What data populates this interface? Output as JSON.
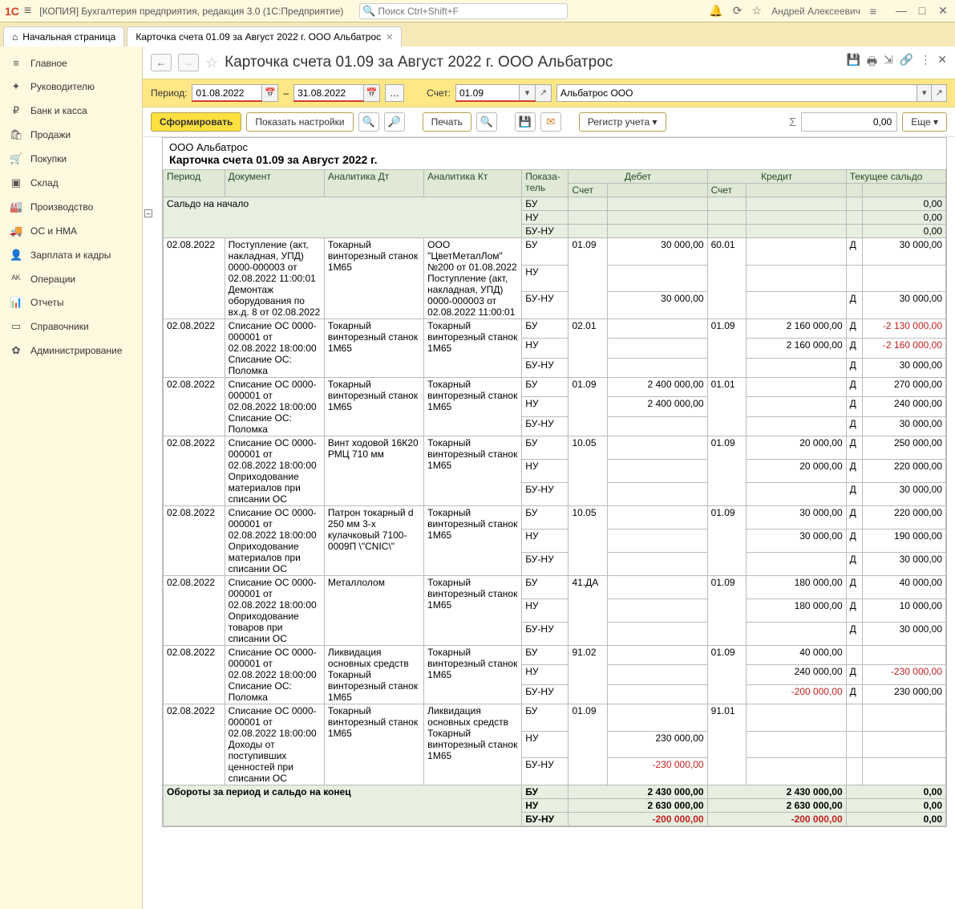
{
  "titlebar": {
    "app_title": "[КОПИЯ] Бухгалтерия предприятия, редакция 3.0  (1С:Предприятие)",
    "search_placeholder": "Поиск Ctrl+Shift+F",
    "user": "Андрей Алексеевич"
  },
  "tabs": {
    "home": "Начальная страница",
    "current": "Карточка счета 01.09 за Август 2022 г. ООО Альбатрос"
  },
  "sidebar": [
    {
      "icon": "≡",
      "label": "Главное"
    },
    {
      "icon": "✦",
      "label": "Руководителю"
    },
    {
      "icon": "₽",
      "label": "Банк и касса"
    },
    {
      "icon": "🛍",
      "label": "Продажи"
    },
    {
      "icon": "🛒",
      "label": "Покупки"
    },
    {
      "icon": "▣",
      "label": "Склад"
    },
    {
      "icon": "🏭",
      "label": "Производство"
    },
    {
      "icon": "🚚",
      "label": "ОС и НМА"
    },
    {
      "icon": "👤",
      "label": "Зарплата и кадры"
    },
    {
      "icon": "ᴬᴷ",
      "label": "Операции"
    },
    {
      "icon": "📊",
      "label": "Отчеты"
    },
    {
      "icon": "▭",
      "label": "Справочники"
    },
    {
      "icon": "✿",
      "label": "Администрирование"
    }
  ],
  "header": {
    "title": "Карточка счета 01.09 за Август 2022 г. ООО Альбатрос"
  },
  "filter": {
    "period_label": "Период:",
    "from": "01.08.2022",
    "dash": "–",
    "to": "31.08.2022",
    "account_label": "Счет:",
    "account": "01.09",
    "org": "Альбатрос ООО"
  },
  "toolbar": {
    "form": "Сформировать",
    "settings": "Показать настройки",
    "print": "Печать",
    "registry": "Регистр учета",
    "sumfield": "0,00",
    "more": "Еще"
  },
  "report": {
    "org": "ООО Альбатрос",
    "title": "Карточка счета 01.09 за Август 2022 г.",
    "columns": {
      "period": "Период",
      "doc": "Документ",
      "adt": "Аналитика Дт",
      "akt": "Аналитика Кт",
      "ind": "Показа-\nтель",
      "debit": "Дебет",
      "credit": "Кредит",
      "balance": "Текущее сальдо",
      "acc": "Счет"
    },
    "opening_label": "Сальдо на начало",
    "opening": {
      "bu": "0,00",
      "nu": "0,00",
      "bunu": "0,00"
    },
    "rows": [
      {
        "date": "02.08.2022",
        "doc": "Поступление (акт, накладная, УПД) 0000-000003 от 02.08.2022 11:00:01\nДемонтаж оборудования по вх.д. 8 от 02.08.2022",
        "adt": "Токарный винторезный станок 1М65",
        "akt": "ООО \"ЦветМеталЛом\" №200 от 01.08.2022\nПоступление (акт, накладная, УПД) 0000-000003 от 02.08.2022 11:00:01",
        "lines": [
          {
            "ind": "БУ",
            "dacc": "01.09",
            "dsum": "30 000,00",
            "cacc": "60.01",
            "csum": "",
            "side": "Д",
            "bal": "30 000,00"
          },
          {
            "ind": "НУ",
            "dacc": "",
            "dsum": "",
            "cacc": "",
            "csum": "",
            "side": "",
            "bal": ""
          },
          {
            "ind": "БУ-НУ",
            "dacc": "",
            "dsum": "30 000,00",
            "cacc": "",
            "csum": "",
            "side": "Д",
            "bal": "30 000,00"
          }
        ]
      },
      {
        "date": "02.08.2022",
        "doc": "Списание ОС 0000-000001 от 02.08.2022 18:00:00\nСписание ОС: Поломка",
        "adt": "Токарный винторезный станок 1М65",
        "akt": "Токарный винторезный станок 1М65",
        "lines": [
          {
            "ind": "БУ",
            "dacc": "02.01",
            "dsum": "",
            "cacc": "01.09",
            "csum": "2 160 000,00",
            "side": "Д",
            "bal": "-2 130 000,00",
            "neg": true
          },
          {
            "ind": "НУ",
            "dacc": "",
            "dsum": "",
            "cacc": "",
            "csum": "2 160 000,00",
            "side": "Д",
            "bal": "-2 160 000,00",
            "neg": true
          },
          {
            "ind": "БУ-НУ",
            "dacc": "",
            "dsum": "",
            "cacc": "",
            "csum": "",
            "side": "Д",
            "bal": "30 000,00"
          }
        ]
      },
      {
        "date": "02.08.2022",
        "doc": "Списание ОС 0000-000001 от 02.08.2022 18:00:00\nСписание ОС: Поломка",
        "adt": "Токарный винторезный станок 1М65",
        "akt": "Токарный винторезный станок 1М65",
        "lines": [
          {
            "ind": "БУ",
            "dacc": "01.09",
            "dsum": "2 400 000,00",
            "cacc": "01.01",
            "csum": "",
            "side": "Д",
            "bal": "270 000,00"
          },
          {
            "ind": "НУ",
            "dacc": "",
            "dsum": "2 400 000,00",
            "cacc": "",
            "csum": "",
            "side": "Д",
            "bal": "240 000,00"
          },
          {
            "ind": "БУ-НУ",
            "dacc": "",
            "dsum": "",
            "cacc": "",
            "csum": "",
            "side": "Д",
            "bal": "30 000,00"
          }
        ]
      },
      {
        "date": "02.08.2022",
        "doc": "Списание ОС 0000-000001 от 02.08.2022 18:00:00\nОприходование материалов при списании ОС",
        "adt": "Винт ходовой 16К20 РМЦ 710 мм",
        "akt": "Токарный винторезный станок 1М65",
        "lines": [
          {
            "ind": "БУ",
            "dacc": "10.05",
            "dsum": "",
            "cacc": "01.09",
            "csum": "20 000,00",
            "side": "Д",
            "bal": "250 000,00"
          },
          {
            "ind": "НУ",
            "dacc": "",
            "dsum": "",
            "cacc": "",
            "csum": "20 000,00",
            "side": "Д",
            "bal": "220 000,00"
          },
          {
            "ind": "БУ-НУ",
            "dacc": "",
            "dsum": "",
            "cacc": "",
            "csum": "",
            "side": "Д",
            "bal": "30 000,00"
          }
        ]
      },
      {
        "date": "02.08.2022",
        "doc": "Списание ОС 0000-000001 от 02.08.2022 18:00:00\nОприходование материалов при списании ОС",
        "adt": "Патрон токарный d 250 мм 3-х кулачковый 7100-0009П \\\"CNIC\\\"",
        "akt": "Токарный винторезный станок 1М65",
        "lines": [
          {
            "ind": "БУ",
            "dacc": "10.05",
            "dsum": "",
            "cacc": "01.09",
            "csum": "30 000,00",
            "side": "Д",
            "bal": "220 000,00"
          },
          {
            "ind": "НУ",
            "dacc": "",
            "dsum": "",
            "cacc": "",
            "csum": "30 000,00",
            "side": "Д",
            "bal": "190 000,00"
          },
          {
            "ind": "БУ-НУ",
            "dacc": "",
            "dsum": "",
            "cacc": "",
            "csum": "",
            "side": "Д",
            "bal": "30 000,00"
          }
        ]
      },
      {
        "date": "02.08.2022",
        "doc": "Списание ОС 0000-000001 от 02.08.2022 18:00:00\nОприходование товаров при списании ОС",
        "adt": "Металлолом",
        "akt": "Токарный винторезный станок 1М65",
        "lines": [
          {
            "ind": "БУ",
            "dacc": "41.ДА",
            "dsum": "",
            "cacc": "01.09",
            "csum": "180 000,00",
            "side": "Д",
            "bal": "40 000,00"
          },
          {
            "ind": "НУ",
            "dacc": "",
            "dsum": "",
            "cacc": "",
            "csum": "180 000,00",
            "side": "Д",
            "bal": "10 000,00"
          },
          {
            "ind": "БУ-НУ",
            "dacc": "",
            "dsum": "",
            "cacc": "",
            "csum": "",
            "side": "Д",
            "bal": "30 000,00"
          }
        ]
      },
      {
        "date": "02.08.2022",
        "doc": "Списание ОС 0000-000001 от 02.08.2022 18:00:00\nСписание ОС: Поломка",
        "adt": "Ликвидация основных средств\nТокарный винторезный станок 1М65",
        "akt": "Токарный винторезный станок 1М65",
        "lines": [
          {
            "ind": "БУ",
            "dacc": "91.02",
            "dsum": "",
            "cacc": "01.09",
            "csum": "40 000,00",
            "side": "",
            "bal": ""
          },
          {
            "ind": "НУ",
            "dacc": "",
            "dsum": "",
            "cacc": "",
            "csum": "240 000,00",
            "side": "Д",
            "bal": "-230 000,00",
            "neg": true
          },
          {
            "ind": "БУ-НУ",
            "dacc": "",
            "dsum": "",
            "cacc": "",
            "csum": "-200 000,00",
            "cneg": true,
            "side": "Д",
            "bal": "230 000,00"
          }
        ]
      },
      {
        "date": "02.08.2022",
        "doc": "Списание ОС 0000-000001 от 02.08.2022 18:00:00\nДоходы от поступивших ценностей при списании ОС",
        "adt": "Токарный винторезный станок 1М65",
        "akt": "Ликвидация основных средств\nТокарный винторезный станок 1М65",
        "lines": [
          {
            "ind": "БУ",
            "dacc": "01.09",
            "dsum": "",
            "cacc": "91.01",
            "csum": "",
            "side": "",
            "bal": ""
          },
          {
            "ind": "НУ",
            "dacc": "",
            "dsum": "230 000,00",
            "cacc": "",
            "csum": "",
            "side": "",
            "bal": ""
          },
          {
            "ind": "БУ-НУ",
            "dacc": "",
            "dsum": "-230 000,00",
            "dneg": true,
            "cacc": "",
            "csum": "",
            "side": "",
            "bal": ""
          }
        ]
      }
    ],
    "totals_label": "Обороты за период и сальдо на конец",
    "totals": [
      {
        "ind": "БУ",
        "dsum": "2 430 000,00",
        "csum": "2 430 000,00",
        "bal": "0,00"
      },
      {
        "ind": "НУ",
        "dsum": "2 630 000,00",
        "csum": "2 630 000,00",
        "bal": "0,00"
      },
      {
        "ind": "БУ-НУ",
        "dsum": "-200 000,00",
        "dneg": true,
        "csum": "-200 000,00",
        "cneg": true,
        "bal": "0,00"
      }
    ]
  }
}
